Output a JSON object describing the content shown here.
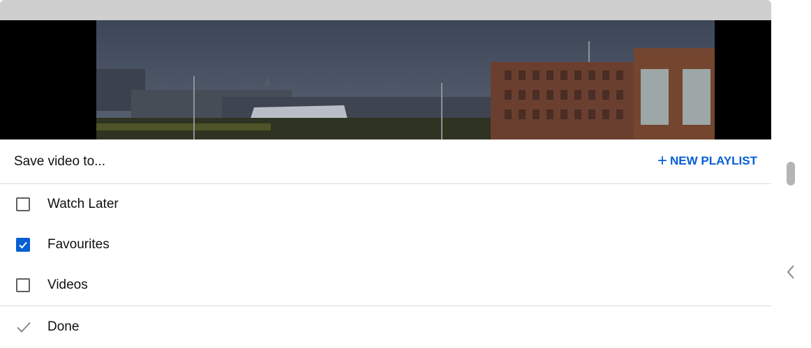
{
  "dialog": {
    "title": "Save video to...",
    "new_playlist_label": "NEW PLAYLIST",
    "new_playlist_icon": "plus-icon",
    "playlists": [
      {
        "label": "Watch Later",
        "checked": false
      },
      {
        "label": "Favourites",
        "checked": true
      },
      {
        "label": "Videos",
        "checked": false
      }
    ],
    "done_label": "Done",
    "done_icon": "check-icon"
  },
  "colors": {
    "accent": "#065fd4",
    "text": "#0f0f0f",
    "divider": "#dcdcdc"
  }
}
